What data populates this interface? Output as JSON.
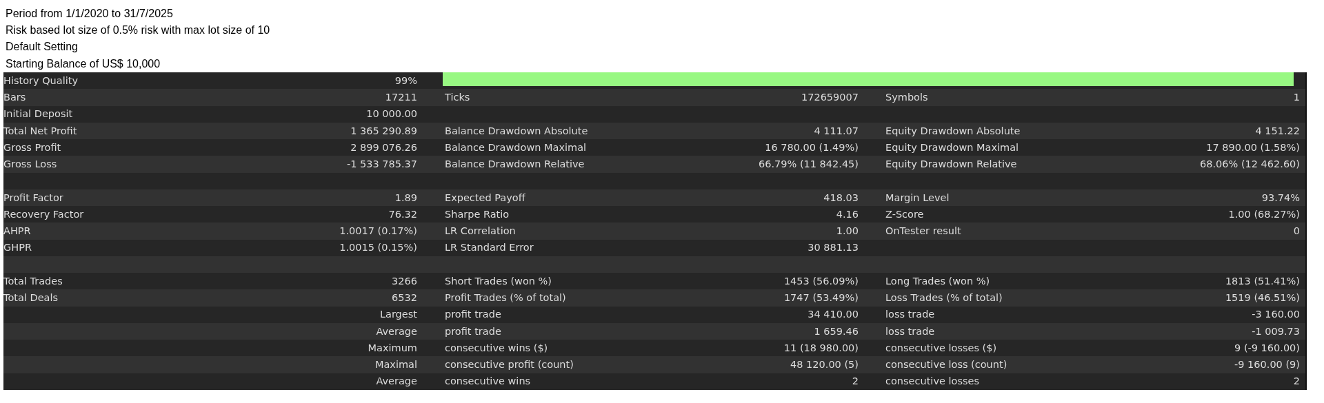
{
  "notes": [
    "Period from 1/1/2020 to 31/7/2025",
    "Risk based lot size of 0.5% risk with max lot size of 10",
    "Default Setting",
    "Starting Balance of US$ 10,000"
  ],
  "table": {
    "rows": [
      {
        "kind": "quality",
        "groups": [
          {
            "label": "History Quality",
            "value": "99%"
          }
        ],
        "level": 0.99
      },
      {
        "kind": "stats",
        "groups": [
          {
            "label": "Bars",
            "value": "17211"
          },
          {
            "label": "Ticks",
            "value": "172659007"
          },
          {
            "label": "Symbols",
            "value": "1"
          }
        ]
      },
      {
        "kind": "stats",
        "groups": [
          {
            "label": "Initial Deposit",
            "value": "10 000.00"
          }
        ]
      },
      {
        "kind": "stats",
        "groups": [
          {
            "label": "Total Net Profit",
            "value": "1 365 290.89"
          },
          {
            "label": "Balance Drawdown Absolute",
            "value": "4 111.07"
          },
          {
            "label": "Equity Drawdown Absolute",
            "value": "4 151.22"
          }
        ]
      },
      {
        "kind": "stats",
        "groups": [
          {
            "label": "Gross Profit",
            "value": "2 899 076.26"
          },
          {
            "label": "Balance Drawdown Maximal",
            "value": "16 780.00 (1.49%)"
          },
          {
            "label": "Equity Drawdown Maximal",
            "value": "17 890.00 (1.58%)"
          }
        ]
      },
      {
        "kind": "stats",
        "groups": [
          {
            "label": "Gross Loss",
            "value": "-1 533 785.37"
          },
          {
            "label": "Balance Drawdown Relative",
            "value": "66.79% (11 842.45)"
          },
          {
            "label": "Equity Drawdown Relative",
            "value": "68.06% (12 462.60)"
          }
        ]
      },
      {
        "kind": "blank"
      },
      {
        "kind": "stats",
        "groups": [
          {
            "label": "Profit Factor",
            "value": "1.89"
          },
          {
            "label": "Expected Payoff",
            "value": "418.03"
          },
          {
            "label": "Margin Level",
            "value": "93.74%"
          }
        ]
      },
      {
        "kind": "stats",
        "groups": [
          {
            "label": "Recovery Factor",
            "value": "76.32"
          },
          {
            "label": "Sharpe Ratio",
            "value": "4.16"
          },
          {
            "label": "Z-Score",
            "value": "1.00 (68.27%)"
          }
        ]
      },
      {
        "kind": "stats",
        "groups": [
          {
            "label": "AHPR",
            "value": "1.0017 (0.17%)"
          },
          {
            "label": "LR Correlation",
            "value": "1.00"
          },
          {
            "label": "OnTester result",
            "value": "0"
          }
        ]
      },
      {
        "kind": "stats",
        "groups": [
          {
            "label": "GHPR",
            "value": "1.0015 (0.15%)"
          },
          {
            "label": "LR Standard Error",
            "value": "30 881.13"
          }
        ]
      },
      {
        "kind": "blank"
      },
      {
        "kind": "stats",
        "groups": [
          {
            "label": "Total Trades",
            "value": "3266"
          },
          {
            "label": "Short Trades (won %)",
            "value": "1453 (56.09%)"
          },
          {
            "label": "Long Trades (won %)",
            "value": "1813 (51.41%)"
          }
        ]
      },
      {
        "kind": "stats",
        "groups": [
          {
            "label": "Total Deals",
            "value": "6532"
          },
          {
            "label": "Profit Trades (% of total)",
            "value": "1747 (53.49%)"
          },
          {
            "label": "Loss Trades (% of total)",
            "value": "1519 (46.51%)"
          }
        ]
      },
      {
        "kind": "stats",
        "groups": [
          {
            "value": "Largest"
          },
          {
            "label": "profit trade",
            "value": "34 410.00"
          },
          {
            "label": "loss trade",
            "value": "-3 160.00"
          }
        ]
      },
      {
        "kind": "stats",
        "groups": [
          {
            "value": "Average"
          },
          {
            "label": "profit trade",
            "value": "1 659.46"
          },
          {
            "label": "loss trade",
            "value": "-1 009.73"
          }
        ]
      },
      {
        "kind": "stats",
        "groups": [
          {
            "value": "Maximum"
          },
          {
            "label": "consecutive wins ($)",
            "value": "11 (18 980.00)"
          },
          {
            "label": "consecutive losses ($)",
            "value": "9 (-9 160.00)"
          }
        ]
      },
      {
        "kind": "stats",
        "groups": [
          {
            "value": "Maximal"
          },
          {
            "label": "consecutive profit (count)",
            "value": "48 120.00 (5)"
          },
          {
            "label": "consecutive loss (count)",
            "value": "-9 160.00 (9)"
          }
        ]
      },
      {
        "kind": "stats",
        "groups": [
          {
            "value": "Average"
          },
          {
            "label": "consecutive wins",
            "value": "2"
          },
          {
            "label": "consecutive losses",
            "value": "2"
          }
        ]
      }
    ]
  }
}
